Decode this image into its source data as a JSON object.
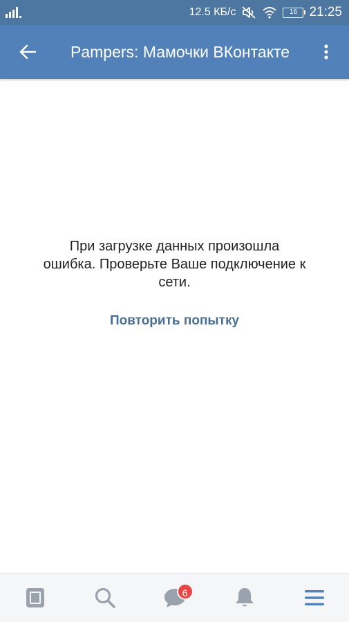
{
  "status_bar": {
    "network_speed": "12.5 КБ/с",
    "battery_level": "16",
    "time": "21:25",
    "icons": [
      "signal-icon",
      "mute-icon",
      "wifi-icon",
      "battery-icon"
    ]
  },
  "toolbar": {
    "title": "Pampers: Мамочки ВКонтакте",
    "back_icon": "arrow-left-icon",
    "more_icon": "more-vertical-icon"
  },
  "error": {
    "message": "При загрузке данных произошла ошибка. Проверьте Ваше подключение к сети.",
    "retry_label": "Повторить попытку"
  },
  "bottom_nav": {
    "items": [
      {
        "icon": "news-icon"
      },
      {
        "icon": "search-icon"
      },
      {
        "icon": "messages-icon",
        "badge": "6"
      },
      {
        "icon": "notifications-icon"
      },
      {
        "icon": "menu-icon",
        "active": true
      }
    ]
  },
  "colors": {
    "status_bar": "#4d76a1",
    "toolbar": "#5181b8",
    "link": "#4a6f96",
    "nav_icon": "#99a2ad",
    "nav_active": "#5181b8",
    "badge": "#e64646"
  }
}
